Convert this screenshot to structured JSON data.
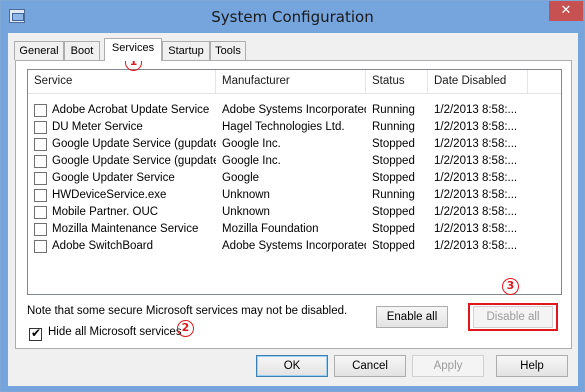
{
  "window": {
    "title": "System Configuration",
    "close_glyph": "✕",
    "app_icon": "system-configuration-icon"
  },
  "tabs": [
    {
      "label": "General"
    },
    {
      "label": "Boot"
    },
    {
      "label": "Services",
      "active": true
    },
    {
      "label": "Startup"
    },
    {
      "label": "Tools"
    }
  ],
  "table": {
    "columns": [
      "Service",
      "Manufacturer",
      "Status",
      "Date Disabled"
    ],
    "rows": [
      {
        "service": "Adobe Acrobat Update Service",
        "manufacturer": "Adobe Systems Incorporated",
        "status": "Running",
        "date": "1/2/2013 8:58:...",
        "checked": false
      },
      {
        "service": "DU Meter Service",
        "manufacturer": "Hagel Technologies Ltd.",
        "status": "Running",
        "date": "1/2/2013 8:58:...",
        "checked": false
      },
      {
        "service": "Google Update Service (gupdate)",
        "manufacturer": "Google Inc.",
        "status": "Stopped",
        "date": "1/2/2013 8:58:...",
        "checked": false
      },
      {
        "service": "Google Update Service (gupdatem)",
        "manufacturer": "Google Inc.",
        "status": "Stopped",
        "date": "1/2/2013 8:58:...",
        "checked": false
      },
      {
        "service": "Google Updater Service",
        "manufacturer": "Google",
        "status": "Stopped",
        "date": "1/2/2013 8:58:...",
        "checked": false
      },
      {
        "service": "HWDeviceService.exe",
        "manufacturer": "Unknown",
        "status": "Running",
        "date": "1/2/2013 8:58:...",
        "checked": false
      },
      {
        "service": "Mobile Partner. OUC",
        "manufacturer": "Unknown",
        "status": "Stopped",
        "date": "1/2/2013 8:58:...",
        "checked": false
      },
      {
        "service": "Mozilla Maintenance Service",
        "manufacturer": "Mozilla Foundation",
        "status": "Stopped",
        "date": "1/2/2013 8:58:...",
        "checked": false
      },
      {
        "service": "Adobe SwitchBoard",
        "manufacturer": "Adobe Systems Incorporated",
        "status": "Stopped",
        "date": "1/2/2013 8:58:...",
        "checked": false
      }
    ]
  },
  "note": "Note that some secure Microsoft services may not be disabled.",
  "enable_all": "Enable all",
  "disable_all": "Disable all",
  "hide_microsoft": {
    "label": "Hide all Microsoft services",
    "checked": true
  },
  "footer": {
    "ok": "OK",
    "cancel": "Cancel",
    "apply": "Apply",
    "help": "Help"
  },
  "markers": {
    "one": "1",
    "two": "2",
    "three": "3"
  },
  "colors": {
    "title_bar": "#75a5dc",
    "close_button": "#c75050",
    "annotation_red": "#e0181e"
  }
}
